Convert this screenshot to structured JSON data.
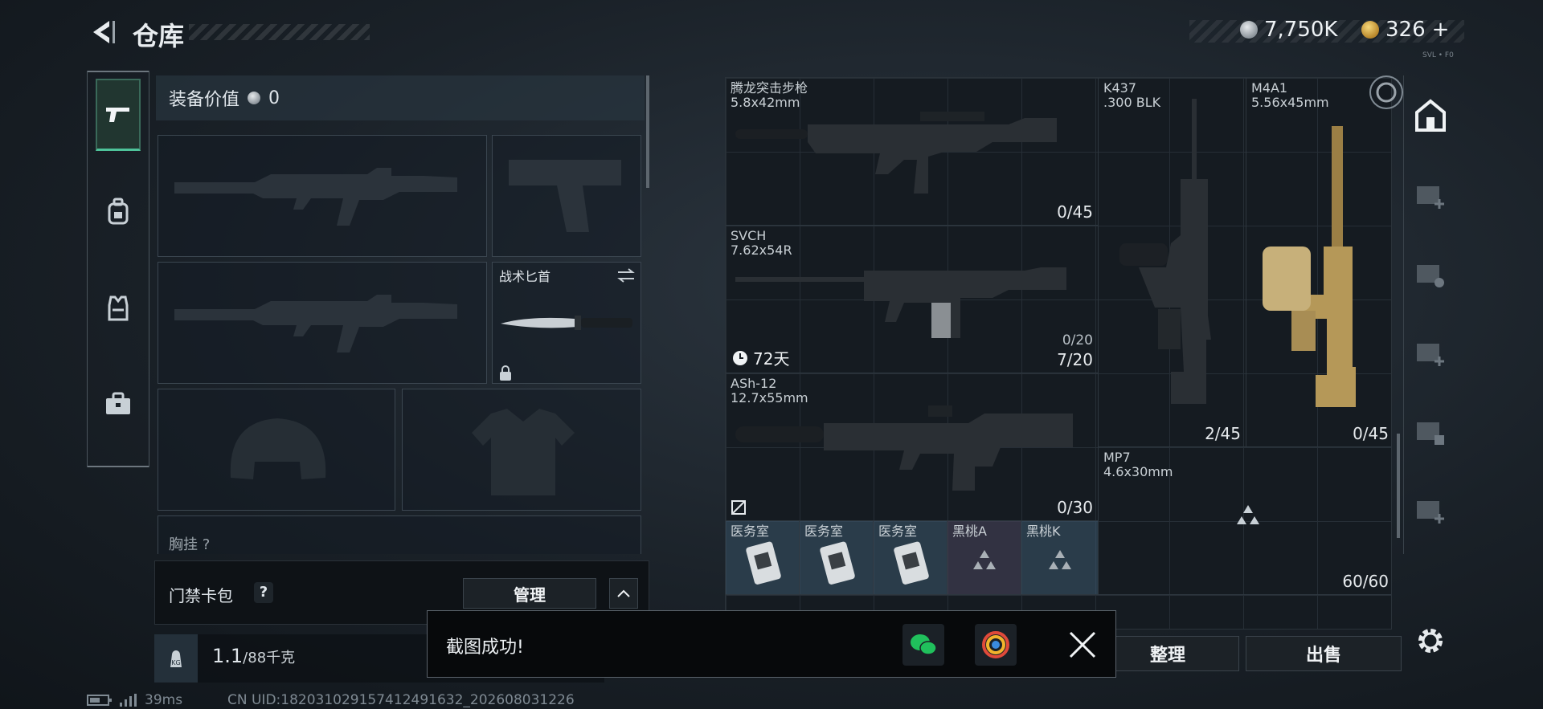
{
  "header": {
    "title": "仓库"
  },
  "currency": {
    "silver": "7,750K",
    "gold": "326",
    "gold_add": "+",
    "corner_tag": "SVL • F0"
  },
  "tabs": [
    {
      "icon": "pistol-icon",
      "active": true
    },
    {
      "icon": "backpack-icon"
    },
    {
      "icon": "vest-icon"
    },
    {
      "icon": "briefcase-icon"
    }
  ],
  "equipment": {
    "value_label": "装备价值",
    "value": "0",
    "knife_label": "战术匕首",
    "section_label": "胸挂 ?"
  },
  "keycard": {
    "label": "门禁卡包",
    "help": "?",
    "manage": "管理"
  },
  "weight": {
    "current": "1.1",
    "max": "/88千克"
  },
  "status": {
    "ping": "39ms",
    "uid": "CN UID:18203102915741249163​2_202608031226"
  },
  "warehouse": {
    "items": [
      {
        "id": "tenglong",
        "name": "腾龙突击步枪\n5.8x42mm",
        "count": "0/45"
      },
      {
        "id": "svch",
        "name": "SVCH\n7.62x54R",
        "count": "7/20",
        "sub_count": "0/20",
        "timer": "72天"
      },
      {
        "id": "ash12",
        "name": "ASh-12\n12.7x55mm",
        "count": "0/30"
      },
      {
        "id": "k437",
        "name": "K437\n.300 BLK",
        "count": "2/45"
      },
      {
        "id": "m4a1",
        "name": "M4A1\n5.56x45mm",
        "count": "0/45"
      },
      {
        "id": "mp7",
        "name": "MP7\n4.6x30mm",
        "count": "60/60"
      },
      {
        "id": "med1",
        "name": "医务室"
      },
      {
        "id": "med2",
        "name": "医务室"
      },
      {
        "id": "med3",
        "name": "医务室"
      },
      {
        "id": "heartA",
        "name": "黑桃A"
      },
      {
        "id": "heartK",
        "name": "黑桃K"
      }
    ]
  },
  "actions": {
    "sort": "整理",
    "sell": "出售"
  },
  "toast": {
    "message": "截图成功!"
  }
}
